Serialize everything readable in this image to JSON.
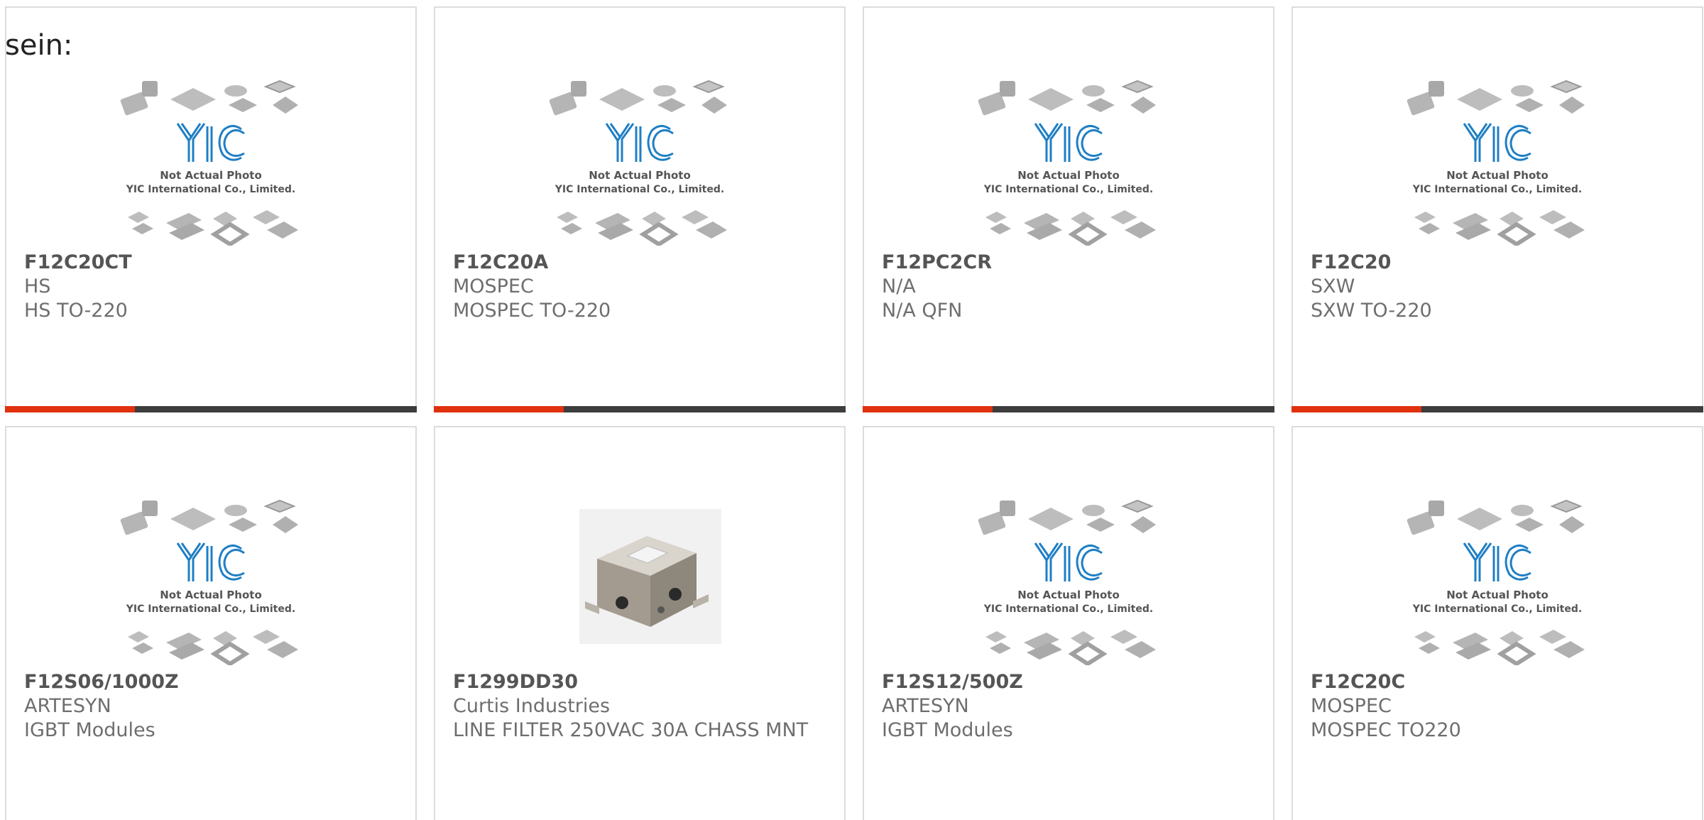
{
  "lead_text": "sein:",
  "placeholder_image": {
    "line1": "Not Actual Photo",
    "line2": "YIC International Co., Limited."
  },
  "brand_color_blue": "#1f7fc4",
  "accent_color": "#e0310f",
  "products": [
    {
      "part_number": "F12C20CT",
      "manufacturer": "HS",
      "description": "HS TO-220",
      "image": "placeholder",
      "hover_bar": true
    },
    {
      "part_number": "F12C20A",
      "manufacturer": "MOSPEC",
      "description": "MOSPEC TO-220",
      "image": "placeholder",
      "hover_bar": true
    },
    {
      "part_number": "F12PC2CR",
      "manufacturer": "N/A",
      "description": "N/A QFN",
      "image": "placeholder",
      "hover_bar": true
    },
    {
      "part_number": "F12C20",
      "manufacturer": "SXW",
      "description": "SXW TO-220",
      "image": "placeholder",
      "hover_bar": true
    },
    {
      "part_number": "F12S06/1000Z",
      "manufacturer": "ARTESYN",
      "description": "IGBT Modules",
      "image": "placeholder",
      "hover_bar": false
    },
    {
      "part_number": "F1299DD30",
      "manufacturer": "Curtis Industries",
      "description": "LINE FILTER 250VAC 30A CHASS MNT",
      "image": "line-filter-photo",
      "hover_bar": false
    },
    {
      "part_number": "F12S12/500Z",
      "manufacturer": "ARTESYN",
      "description": "IGBT Modules",
      "image": "placeholder",
      "hover_bar": false
    },
    {
      "part_number": "F12C20C",
      "manufacturer": "MOSPEC",
      "description": "MOSPEC TO220",
      "image": "placeholder",
      "hover_bar": false
    }
  ]
}
